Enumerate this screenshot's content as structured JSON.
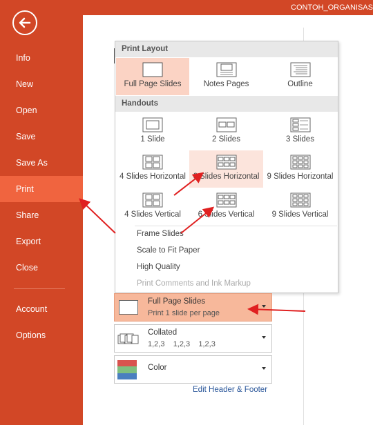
{
  "header": {
    "org_name": "CONTOH_ORGANISAS"
  },
  "nav": {
    "back_icon": "back-arrow-icon",
    "items": [
      {
        "label": "Info"
      },
      {
        "label": "New"
      },
      {
        "label": "Open"
      },
      {
        "label": "Save"
      },
      {
        "label": "Save As"
      },
      {
        "label": "Print",
        "active": true
      },
      {
        "label": "Share"
      },
      {
        "label": "Export"
      },
      {
        "label": "Close"
      },
      {
        "label": "Account"
      },
      {
        "label": "Options"
      }
    ]
  },
  "dropdown": {
    "print_layout_header": "Print Layout",
    "print_layouts": [
      "Full Page Slides",
      "Notes Pages",
      "Outline"
    ],
    "handouts_header": "Handouts",
    "handouts": [
      "1 Slide",
      "2 Slides",
      "3 Slides",
      "4 Slides Horizontal",
      "6 Slides Horizontal",
      "9 Slides Horizontal",
      "4 Slides Vertical",
      "6 Slides Vertical",
      "9 Slides Vertical"
    ],
    "options": [
      "Frame Slides",
      "Scale to Fit Paper",
      "High Quality",
      "Print Comments and Ink Markup"
    ]
  },
  "settings": {
    "layout": {
      "title": "Full Page Slides",
      "subtitle": "Print 1 slide per page"
    },
    "collate": {
      "title": "Collated",
      "subtitle": "1,2,3    1,2,3    1,2,3"
    },
    "color": {
      "title": "Color"
    }
  },
  "edit_header_footer": "Edit Header & Footer",
  "colors": {
    "backstage": "#d24726",
    "active": "#f0643f",
    "selection": "#fbd3c4",
    "arrow": "#e02020"
  }
}
